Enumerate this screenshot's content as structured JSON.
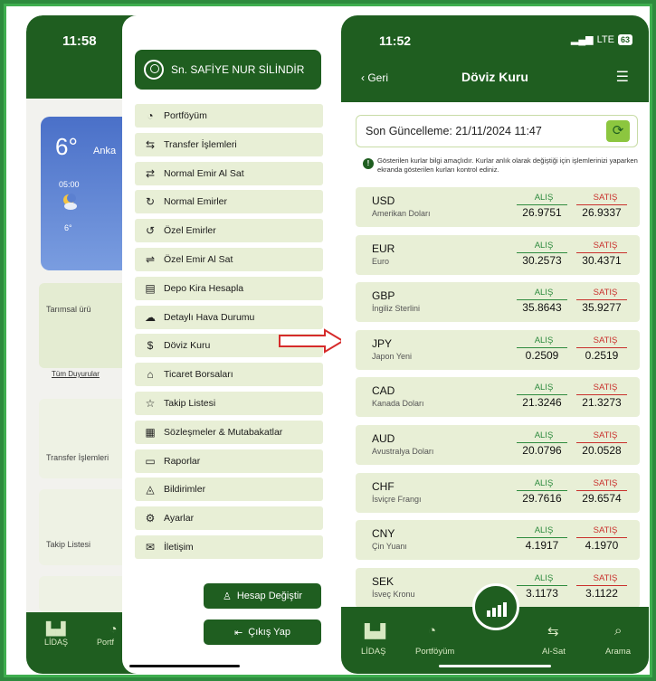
{
  "left_phone": {
    "time": "11:58",
    "weather": {
      "temp": "6°",
      "city": "Anka",
      "hour": "05:00",
      "low": "6°"
    },
    "cards": [
      "Tarımsal ürü",
      "Transfer İşlemleri",
      "Takip Listesi"
    ],
    "all_announcements": "Tüm Duyurular",
    "tabbar": [
      "LİDAŞ",
      "Portf"
    ]
  },
  "drawer": {
    "user_name": "Sn. SAFİYE NUR SİLİNDİR",
    "items": [
      {
        "label": "Portföyüm",
        "icon": "◔"
      },
      {
        "label": "Transfer İşlemleri",
        "icon": "⇆"
      },
      {
        "label": "Normal Emir Al Sat",
        "icon": "⇄"
      },
      {
        "label": "Normal Emirler",
        "icon": "↻"
      },
      {
        "label": "Özel Emirler",
        "icon": "↺"
      },
      {
        "label": "Özel Emir Al Sat",
        "icon": "⇌"
      },
      {
        "label": "Depo Kira Hesapla",
        "icon": "▤"
      },
      {
        "label": "Detaylı Hava Durumu",
        "icon": "☁"
      },
      {
        "label": "Döviz Kuru",
        "icon": "$"
      },
      {
        "label": "Ticaret Borsaları",
        "icon": "⌂"
      },
      {
        "label": "Takip Listesi",
        "icon": "☆"
      },
      {
        "label": "Sözleşmeler & Mutabakatlar",
        "icon": "▦"
      },
      {
        "label": "Raporlar",
        "icon": "▭"
      },
      {
        "label": "Bildirimler",
        "icon": "◬"
      },
      {
        "label": "Ayarlar",
        "icon": "⚙"
      },
      {
        "label": "İletişim",
        "icon": "✉"
      }
    ],
    "switch_account": "Hesap Değiştir",
    "logout": "Çıkış Yap"
  },
  "right_phone": {
    "time": "11:52",
    "signal": "LTE",
    "battery": "63",
    "back": "Geri",
    "title": "Döviz Kuru",
    "last_update": "Son Güncelleme: 21/11/2024 11:47",
    "info": "Gösterilen kurlar bilgi amaçlıdır. Kurlar anlık olarak değiştiği için işlemlerinizi yaparken ekranda gösterilen kurları kontrol ediniz.",
    "buy_label": "ALIŞ",
    "sell_label": "SATIŞ",
    "rates": [
      {
        "code": "USD",
        "name": "Amerikan Doları",
        "buy": "26.9751",
        "sell": "26.9337"
      },
      {
        "code": "EUR",
        "name": "Euro",
        "buy": "30.2573",
        "sell": "30.4371"
      },
      {
        "code": "GBP",
        "name": "İngiliz Sterlini",
        "buy": "35.8643",
        "sell": "35.9277"
      },
      {
        "code": "JPY",
        "name": "Japon Yeni",
        "buy": "0.2509",
        "sell": "0.2519"
      },
      {
        "code": "CAD",
        "name": "Kanada Doları",
        "buy": "21.3246",
        "sell": "21.3273"
      },
      {
        "code": "AUD",
        "name": "Avustralya Doları",
        "buy": "20.0796",
        "sell": "20.0528"
      },
      {
        "code": "CHF",
        "name": "İsviçre Frangı",
        "buy": "29.7616",
        "sell": "29.6574"
      },
      {
        "code": "CNY",
        "name": "Çin Yuanı",
        "buy": "4.1917",
        "sell": "4.1970"
      },
      {
        "code": "SEK",
        "name": "İsveç Kronu",
        "buy": "3.1173",
        "sell": "3.1122"
      }
    ],
    "tabbar": [
      "LİDAŞ",
      "Portföyüm",
      "Al-Sat",
      "Arama"
    ]
  }
}
